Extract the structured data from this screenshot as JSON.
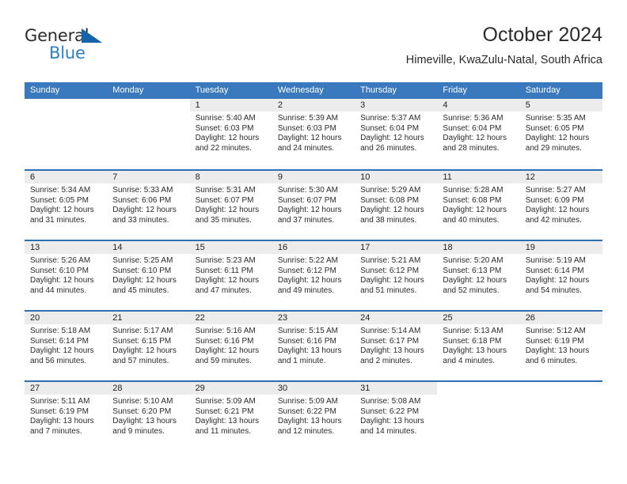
{
  "logo": {
    "line1": "General",
    "line2": "Blue",
    "triangle_icon": "logo-triangle-icon",
    "colors": {
      "general": "#2b2b2b",
      "blue": "#2a7fc9",
      "triangle": "#1464aa"
    }
  },
  "header": {
    "title": "October 2024",
    "subtitle": "Himeville, KwaZulu-Natal, South Africa"
  },
  "theme": {
    "header_band": "#3a79bd",
    "row_divider": "#2f6db1",
    "day_band": "#ececec",
    "text": "#2b2b2b"
  },
  "calendar": {
    "weekday_headers": [
      "Sunday",
      "Monday",
      "Tuesday",
      "Wednesday",
      "Thursday",
      "Friday",
      "Saturday"
    ],
    "weeks": [
      [
        {
          "empty": true
        },
        {
          "empty": true
        },
        {
          "day": "1",
          "sunrise": "Sunrise: 5:40 AM",
          "sunset": "Sunset: 6:03 PM",
          "daylight_line1": "Daylight: 12 hours",
          "daylight_line2": "and 22 minutes."
        },
        {
          "day": "2",
          "sunrise": "Sunrise: 5:39 AM",
          "sunset": "Sunset: 6:03 PM",
          "daylight_line1": "Daylight: 12 hours",
          "daylight_line2": "and 24 minutes."
        },
        {
          "day": "3",
          "sunrise": "Sunrise: 5:37 AM",
          "sunset": "Sunset: 6:04 PM",
          "daylight_line1": "Daylight: 12 hours",
          "daylight_line2": "and 26 minutes."
        },
        {
          "day": "4",
          "sunrise": "Sunrise: 5:36 AM",
          "sunset": "Sunset: 6:04 PM",
          "daylight_line1": "Daylight: 12 hours",
          "daylight_line2": "and 28 minutes."
        },
        {
          "day": "5",
          "sunrise": "Sunrise: 5:35 AM",
          "sunset": "Sunset: 6:05 PM",
          "daylight_line1": "Daylight: 12 hours",
          "daylight_line2": "and 29 minutes."
        }
      ],
      [
        {
          "day": "6",
          "sunrise": "Sunrise: 5:34 AM",
          "sunset": "Sunset: 6:05 PM",
          "daylight_line1": "Daylight: 12 hours",
          "daylight_line2": "and 31 minutes."
        },
        {
          "day": "7",
          "sunrise": "Sunrise: 5:33 AM",
          "sunset": "Sunset: 6:06 PM",
          "daylight_line1": "Daylight: 12 hours",
          "daylight_line2": "and 33 minutes."
        },
        {
          "day": "8",
          "sunrise": "Sunrise: 5:31 AM",
          "sunset": "Sunset: 6:07 PM",
          "daylight_line1": "Daylight: 12 hours",
          "daylight_line2": "and 35 minutes."
        },
        {
          "day": "9",
          "sunrise": "Sunrise: 5:30 AM",
          "sunset": "Sunset: 6:07 PM",
          "daylight_line1": "Daylight: 12 hours",
          "daylight_line2": "and 37 minutes."
        },
        {
          "day": "10",
          "sunrise": "Sunrise: 5:29 AM",
          "sunset": "Sunset: 6:08 PM",
          "daylight_line1": "Daylight: 12 hours",
          "daylight_line2": "and 38 minutes."
        },
        {
          "day": "11",
          "sunrise": "Sunrise: 5:28 AM",
          "sunset": "Sunset: 6:08 PM",
          "daylight_line1": "Daylight: 12 hours",
          "daylight_line2": "and 40 minutes."
        },
        {
          "day": "12",
          "sunrise": "Sunrise: 5:27 AM",
          "sunset": "Sunset: 6:09 PM",
          "daylight_line1": "Daylight: 12 hours",
          "daylight_line2": "and 42 minutes."
        }
      ],
      [
        {
          "day": "13",
          "sunrise": "Sunrise: 5:26 AM",
          "sunset": "Sunset: 6:10 PM",
          "daylight_line1": "Daylight: 12 hours",
          "daylight_line2": "and 44 minutes."
        },
        {
          "day": "14",
          "sunrise": "Sunrise: 5:25 AM",
          "sunset": "Sunset: 6:10 PM",
          "daylight_line1": "Daylight: 12 hours",
          "daylight_line2": "and 45 minutes."
        },
        {
          "day": "15",
          "sunrise": "Sunrise: 5:23 AM",
          "sunset": "Sunset: 6:11 PM",
          "daylight_line1": "Daylight: 12 hours",
          "daylight_line2": "and 47 minutes."
        },
        {
          "day": "16",
          "sunrise": "Sunrise: 5:22 AM",
          "sunset": "Sunset: 6:12 PM",
          "daylight_line1": "Daylight: 12 hours",
          "daylight_line2": "and 49 minutes."
        },
        {
          "day": "17",
          "sunrise": "Sunrise: 5:21 AM",
          "sunset": "Sunset: 6:12 PM",
          "daylight_line1": "Daylight: 12 hours",
          "daylight_line2": "and 51 minutes."
        },
        {
          "day": "18",
          "sunrise": "Sunrise: 5:20 AM",
          "sunset": "Sunset: 6:13 PM",
          "daylight_line1": "Daylight: 12 hours",
          "daylight_line2": "and 52 minutes."
        },
        {
          "day": "19",
          "sunrise": "Sunrise: 5:19 AM",
          "sunset": "Sunset: 6:14 PM",
          "daylight_line1": "Daylight: 12 hours",
          "daylight_line2": "and 54 minutes."
        }
      ],
      [
        {
          "day": "20",
          "sunrise": "Sunrise: 5:18 AM",
          "sunset": "Sunset: 6:14 PM",
          "daylight_line1": "Daylight: 12 hours",
          "daylight_line2": "and 56 minutes."
        },
        {
          "day": "21",
          "sunrise": "Sunrise: 5:17 AM",
          "sunset": "Sunset: 6:15 PM",
          "daylight_line1": "Daylight: 12 hours",
          "daylight_line2": "and 57 minutes."
        },
        {
          "day": "22",
          "sunrise": "Sunrise: 5:16 AM",
          "sunset": "Sunset: 6:16 PM",
          "daylight_line1": "Daylight: 12 hours",
          "daylight_line2": "and 59 minutes."
        },
        {
          "day": "23",
          "sunrise": "Sunrise: 5:15 AM",
          "sunset": "Sunset: 6:16 PM",
          "daylight_line1": "Daylight: 13 hours",
          "daylight_line2": "and 1 minute."
        },
        {
          "day": "24",
          "sunrise": "Sunrise: 5:14 AM",
          "sunset": "Sunset: 6:17 PM",
          "daylight_line1": "Daylight: 13 hours",
          "daylight_line2": "and 2 minutes."
        },
        {
          "day": "25",
          "sunrise": "Sunrise: 5:13 AM",
          "sunset": "Sunset: 6:18 PM",
          "daylight_line1": "Daylight: 13 hours",
          "daylight_line2": "and 4 minutes."
        },
        {
          "day": "26",
          "sunrise": "Sunrise: 5:12 AM",
          "sunset": "Sunset: 6:19 PM",
          "daylight_line1": "Daylight: 13 hours",
          "daylight_line2": "and 6 minutes."
        }
      ],
      [
        {
          "day": "27",
          "sunrise": "Sunrise: 5:11 AM",
          "sunset": "Sunset: 6:19 PM",
          "daylight_line1": "Daylight: 13 hours",
          "daylight_line2": "and 7 minutes."
        },
        {
          "day": "28",
          "sunrise": "Sunrise: 5:10 AM",
          "sunset": "Sunset: 6:20 PM",
          "daylight_line1": "Daylight: 13 hours",
          "daylight_line2": "and 9 minutes."
        },
        {
          "day": "29",
          "sunrise": "Sunrise: 5:09 AM",
          "sunset": "Sunset: 6:21 PM",
          "daylight_line1": "Daylight: 13 hours",
          "daylight_line2": "and 11 minutes."
        },
        {
          "day": "30",
          "sunrise": "Sunrise: 5:09 AM",
          "sunset": "Sunset: 6:22 PM",
          "daylight_line1": "Daylight: 13 hours",
          "daylight_line2": "and 12 minutes."
        },
        {
          "day": "31",
          "sunrise": "Sunrise: 5:08 AM",
          "sunset": "Sunset: 6:22 PM",
          "daylight_line1": "Daylight: 13 hours",
          "daylight_line2": "and 14 minutes."
        },
        {
          "empty": true
        },
        {
          "empty": true
        }
      ]
    ]
  }
}
